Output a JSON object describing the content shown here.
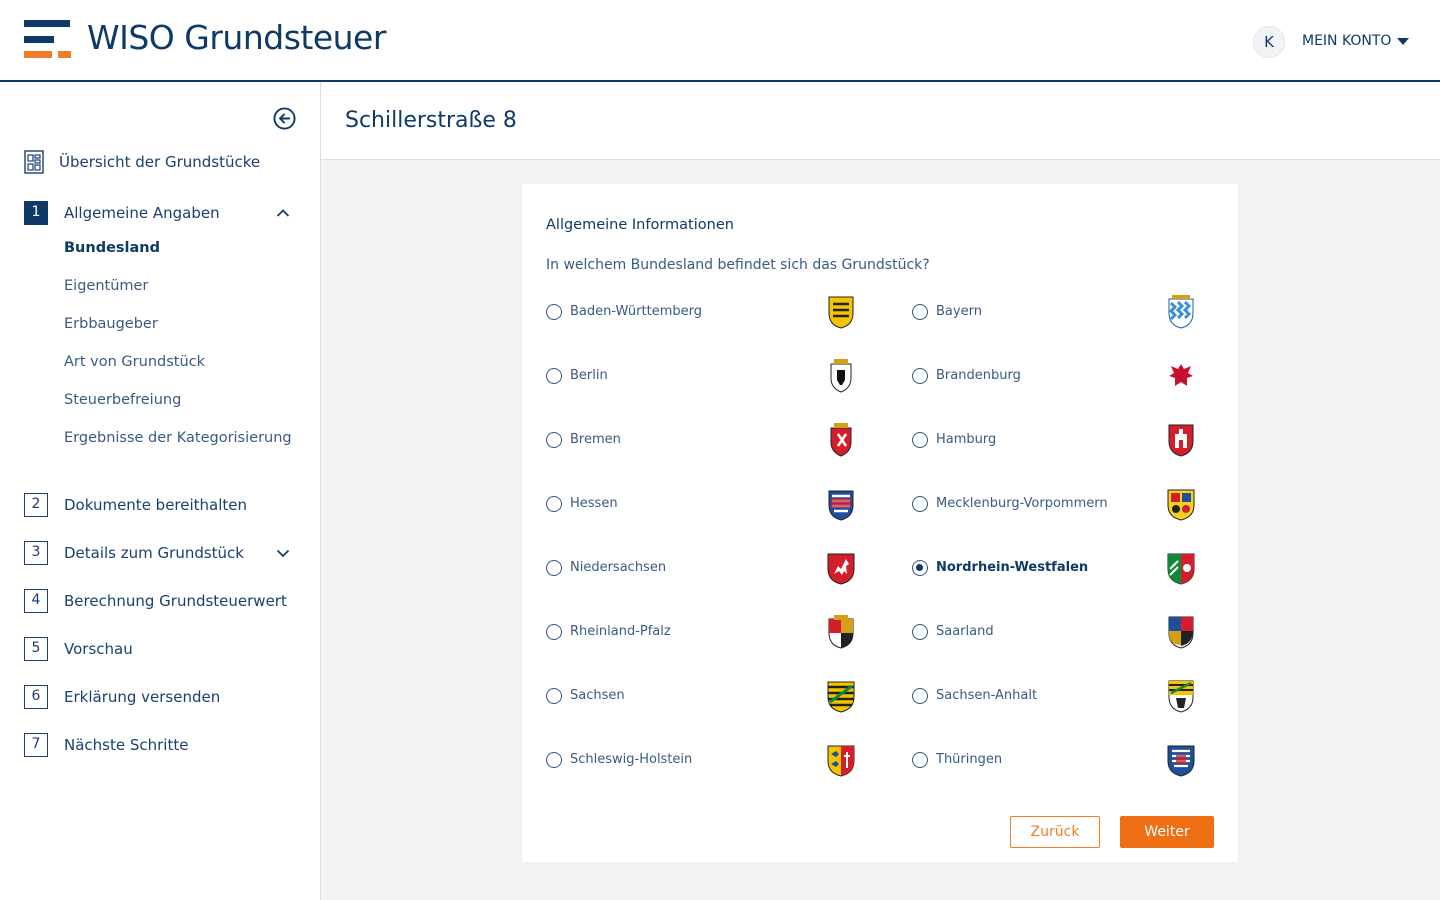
{
  "header": {
    "brand": "WISO Grundsteuer",
    "avatar_initial": "K",
    "account_label": "MEIN KONTO",
    "colors": {
      "navy": "#0f3a67",
      "orange": "#ef7d2b"
    }
  },
  "sidebar": {
    "overview_label": "Übersicht der Grundstücke",
    "steps": [
      {
        "num": "1",
        "label": "Allgemeine Angaben",
        "expanded": true
      },
      {
        "num": "2",
        "label": "Dokumente bereithalten"
      },
      {
        "num": "3",
        "label": "Details zum Grundstück",
        "expandable": true
      },
      {
        "num": "4",
        "label": "Berechnung Grundsteuerwert"
      },
      {
        "num": "5",
        "label": "Vorschau"
      },
      {
        "num": "6",
        "label": "Erklärung versenden"
      },
      {
        "num": "7",
        "label": "Nächste Schritte"
      }
    ],
    "substeps": [
      "Bundesland",
      "Eigentümer",
      "Erbbaugeber",
      "Art von Grundstück",
      "Steuerbefreiung",
      "Ergebnisse der Kategorisierung"
    ]
  },
  "main": {
    "title": "Schillerstraße 8",
    "card_heading": "Allgemeine Informationen",
    "question": "In welchem Bundesland befindet sich das Grundstück?",
    "states": [
      {
        "name": "Baden-Württemberg",
        "crest": "crest-icon-bw"
      },
      {
        "name": "Bayern",
        "crest": "crest-icon-by"
      },
      {
        "name": "Berlin",
        "crest": "crest-icon-be"
      },
      {
        "name": "Brandenburg",
        "crest": "crest-icon-bb"
      },
      {
        "name": "Bremen",
        "crest": "crest-icon-hb"
      },
      {
        "name": "Hamburg",
        "crest": "crest-icon-hh"
      },
      {
        "name": "Hessen",
        "crest": "crest-icon-he"
      },
      {
        "name": "Mecklenburg-Vorpommern",
        "crest": "crest-icon-mv"
      },
      {
        "name": "Niedersachsen",
        "crest": "crest-icon-ni"
      },
      {
        "name": "Nordrhein-Westfalen",
        "crest": "crest-icon-nw"
      },
      {
        "name": "Rheinland-Pfalz",
        "crest": "crest-icon-rp"
      },
      {
        "name": "Saarland",
        "crest": "crest-icon-sl"
      },
      {
        "name": "Sachsen",
        "crest": "crest-icon-sn"
      },
      {
        "name": "Sachsen-Anhalt",
        "crest": "crest-icon-st"
      },
      {
        "name": "Schleswig-Holstein",
        "crest": "crest-icon-sh"
      },
      {
        "name": "Thüringen",
        "crest": "crest-icon-th"
      }
    ],
    "selected_state": "Nordrhein-Westfalen",
    "back_label": "Zurück",
    "next_label": "Weiter"
  }
}
